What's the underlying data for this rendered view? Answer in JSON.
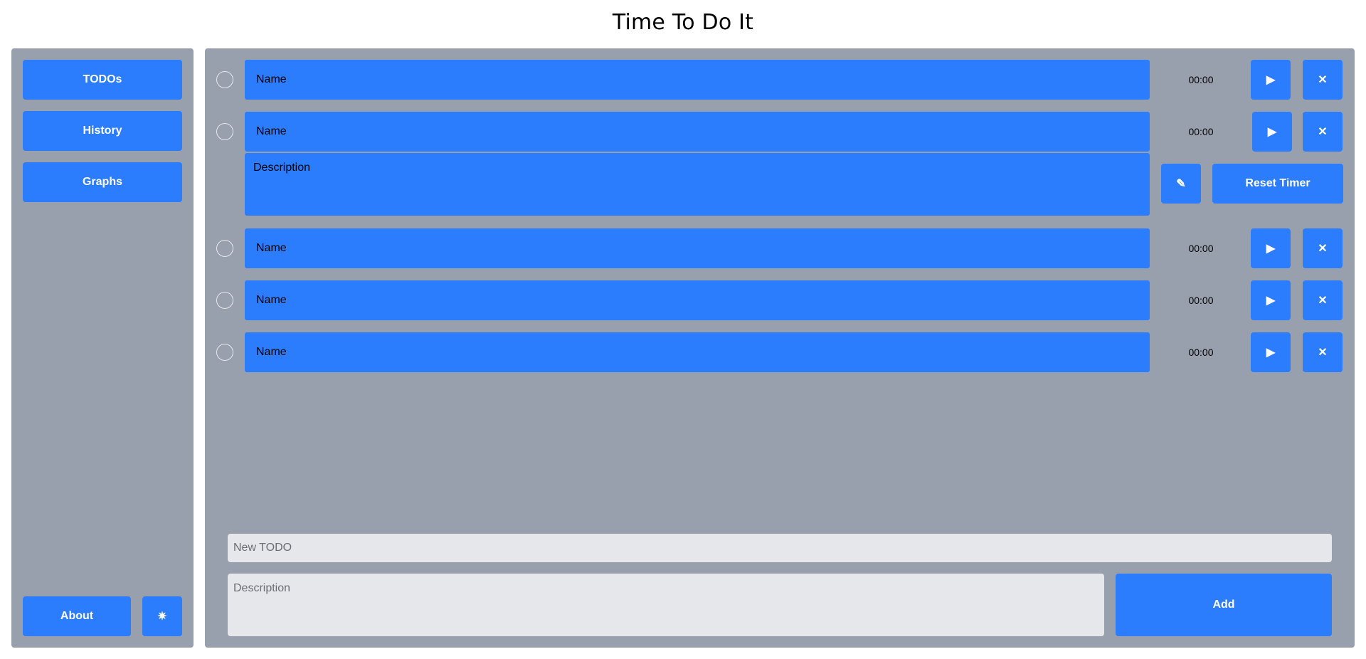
{
  "app": {
    "title": "Time To Do It"
  },
  "sidebar": {
    "nav": [
      {
        "label": "TODOs"
      },
      {
        "label": "History"
      },
      {
        "label": "Graphs"
      }
    ],
    "about_label": "About",
    "theme_icon": "✷"
  },
  "todos": [
    {
      "name": "Name",
      "timer": "00:00",
      "expanded": false
    },
    {
      "name": "Name",
      "timer": "00:00",
      "expanded": true,
      "description": "Description",
      "reset_label": "Reset Timer"
    },
    {
      "name": "Name",
      "timer": "00:00",
      "expanded": false
    },
    {
      "name": "Name",
      "timer": "00:00",
      "expanded": false
    },
    {
      "name": "Name",
      "timer": "00:00",
      "expanded": false
    }
  ],
  "icons": {
    "play": "▶",
    "delete": "✕",
    "edit": "✎"
  },
  "form": {
    "name_placeholder": "New TODO",
    "description_placeholder": "Description",
    "add_label": "Add"
  },
  "colors": {
    "accent": "#2c7dfd",
    "panel": "#98a0ad",
    "input": "#e6e7eb"
  }
}
